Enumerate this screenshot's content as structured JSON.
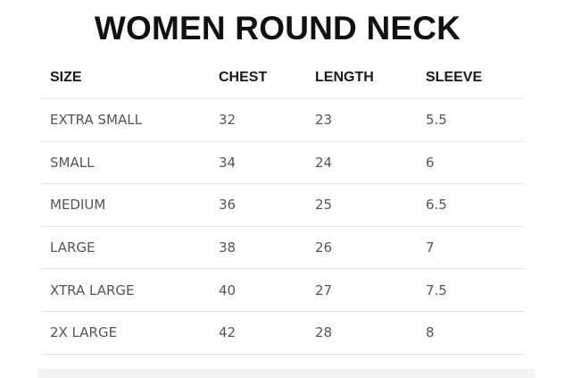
{
  "title": "WOMEN ROUND NECK",
  "table": {
    "headers": {
      "size": "SIZE",
      "chest": "CHEST",
      "length": "LENGTH",
      "sleeve": "SLEEVE"
    },
    "rows": [
      {
        "size": "EXTRA SMALL",
        "chest": "32",
        "length": "23",
        "sleeve": "5.5"
      },
      {
        "size": "SMALL",
        "chest": "34",
        "length": "24",
        "sleeve": "6"
      },
      {
        "size": "MEDIUM",
        "chest": "36",
        "length": "25",
        "sleeve": "6.5"
      },
      {
        "size": "LARGE",
        "chest": "38",
        "length": "26",
        "sleeve": "7"
      },
      {
        "size": "XTRA LARGE",
        "chest": "40",
        "length": "27",
        "sleeve": "7.5"
      },
      {
        "size": "2X LARGE",
        "chest": "42",
        "length": "28",
        "sleeve": "8"
      }
    ]
  }
}
